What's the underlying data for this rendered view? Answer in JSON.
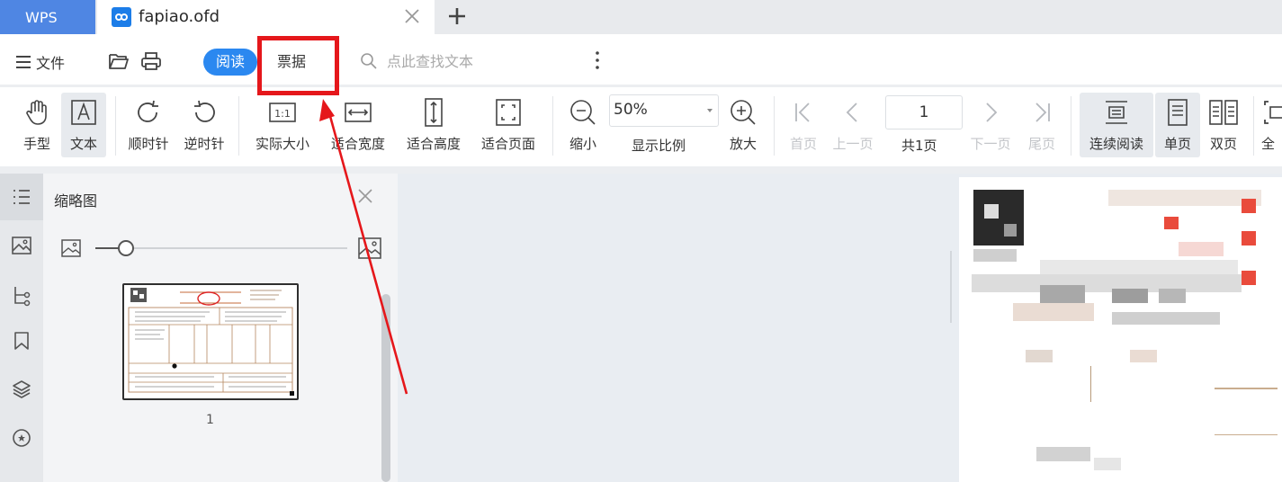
{
  "tabs": {
    "app_tab": "WPS",
    "doc_tab": "fapiao.ofd"
  },
  "menubar": {
    "file_label": "文件",
    "read_mode": "阅读",
    "bill_mode": "票据",
    "search_placeholder": "点此查找文本"
  },
  "toolbar": {
    "hand": "手型",
    "text": "文本",
    "rotate_cw": "顺时针",
    "rotate_ccw": "逆时针",
    "actual_size": "实际大小",
    "fit_width": "适合宽度",
    "fit_height": "适合高度",
    "fit_page": "适合页面",
    "zoom_out": "缩小",
    "zoom_value": "50%",
    "zoom_label": "显示比例",
    "zoom_in": "放大",
    "first_page": "首页",
    "prev_page": "上一页",
    "page_input": "1",
    "page_total": "共1页",
    "next_page": "下一页",
    "last_page": "尾页",
    "continuous": "连续阅读",
    "single": "单页",
    "double": "双页",
    "fullscreen": "全"
  },
  "thumbnail_panel": {
    "title": "缩略图",
    "page_number": "1",
    "slider_level": 0.12
  },
  "colors": {
    "accent": "#2b88f0",
    "wps_tab": "#4f86e3",
    "annotation_red": "#e5171b"
  }
}
